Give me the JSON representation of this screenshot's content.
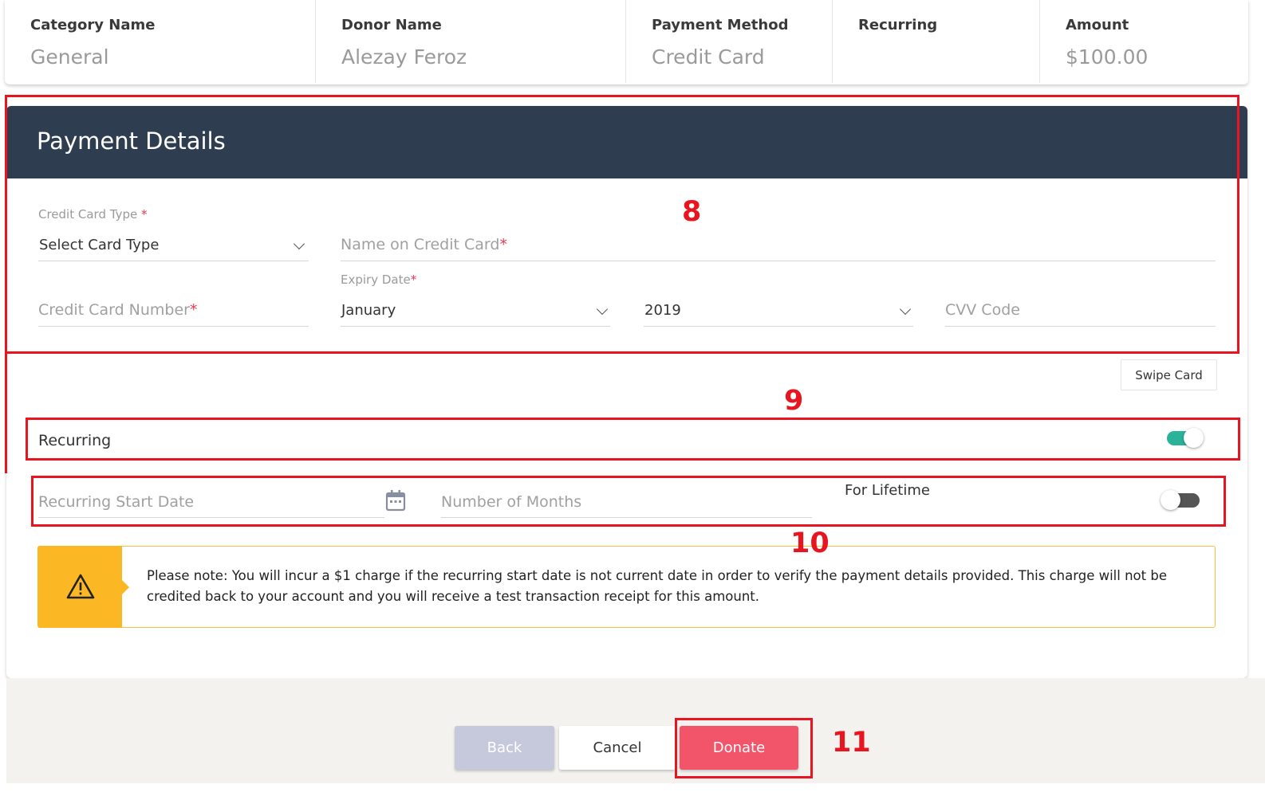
{
  "summary": {
    "category": {
      "label": "Category Name",
      "value": "General"
    },
    "donor": {
      "label": "Donor Name",
      "value": "Alezay Feroz"
    },
    "payment_method": {
      "label": "Payment Method",
      "value": "Credit Card"
    },
    "recurring": {
      "label": "Recurring",
      "value": ""
    },
    "amount": {
      "label": "Amount",
      "value": "$100.00"
    }
  },
  "payment": {
    "title": "Payment Details",
    "card_type": {
      "label": "Credit Card Type",
      "required": "*",
      "value": "Select Card Type"
    },
    "name_on_card": {
      "placeholder": "Name on Credit Card",
      "required": "*"
    },
    "card_number": {
      "placeholder": "Credit Card Number",
      "required": "*"
    },
    "expiry": {
      "label": "Expiry Date",
      "required": "*",
      "month": "January",
      "year": "2019"
    },
    "cvv": {
      "placeholder": "CVV Code"
    },
    "swipe_card": "Swipe Card"
  },
  "recurring": {
    "label": "Recurring",
    "enabled": true,
    "start_date_placeholder": "Recurring Start Date",
    "months_placeholder": "Number of Months",
    "lifetime_label": "For Lifetime",
    "lifetime_enabled": false
  },
  "note": {
    "text": "Please note: You will incur a $1 charge if the recurring start date is not current date in order to verify the payment details provided. This charge will not be credited back to your account and you will receive a test transaction receipt for this amount."
  },
  "buttons": {
    "back": "Back",
    "cancel": "Cancel",
    "donate": "Donate"
  },
  "annotations": {
    "a8": "8",
    "a9": "9",
    "a10": "10",
    "a11": "11"
  },
  "icons": [
    "chevron-down-icon",
    "calendar-icon",
    "warning-icon"
  ],
  "colors": {
    "header": "#2e3e50",
    "accent": "#f25469",
    "toggle_on": "#2bb39a",
    "warning": "#fbb824",
    "annotation": "#e8141f"
  }
}
